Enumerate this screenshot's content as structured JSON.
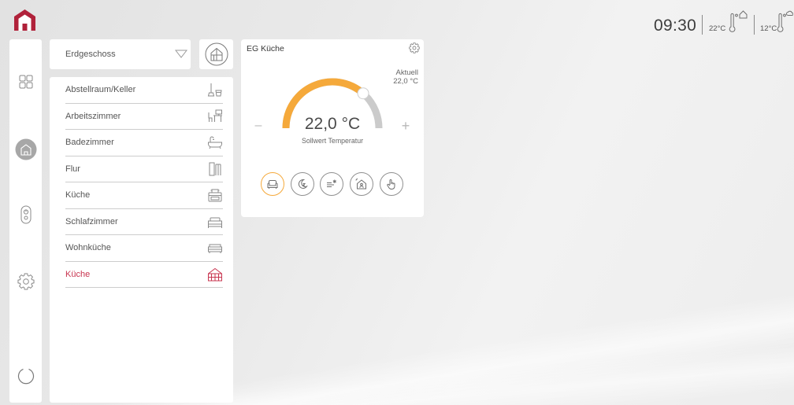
{
  "app": {
    "logo_icon": "home-logo-icon",
    "brand_color": "#b0213a",
    "accent_color": "#f5a93b",
    "selected_color": "#c8344f"
  },
  "header": {
    "time": "09:30",
    "indoor": {
      "temperature": "22°C",
      "icon": "thermometer-home-icon"
    },
    "outdoor": {
      "temperature": "12°C",
      "icon": "thermometer-weather-icon"
    }
  },
  "sidebar": {
    "items": [
      {
        "icon": "grid-icon",
        "active": false
      },
      {
        "icon": "home-icon",
        "active": true
      },
      {
        "icon": "remote-control-icon",
        "active": false
      },
      {
        "icon": "gear-icon",
        "active": false
      },
      {
        "icon": "refresh-icon",
        "active": false
      }
    ]
  },
  "floor_select": {
    "value": "Erdgeschoss",
    "icon": "chevron-down-icon"
  },
  "floorplan_button": {
    "icon": "floorplan-icon"
  },
  "rooms": [
    {
      "label": "Abstellraum/Keller",
      "icon": "storage-icon",
      "selected": false
    },
    {
      "label": "Arbeitszimmer",
      "icon": "desk-icon",
      "selected": false
    },
    {
      "label": "Badezimmer",
      "icon": "bathtub-icon",
      "selected": false
    },
    {
      "label": "Flur",
      "icon": "hallway-icon",
      "selected": false
    },
    {
      "label": "Küche",
      "icon": "stove-icon",
      "selected": false
    },
    {
      "label": "Schlafzimmer",
      "icon": "bed-icon",
      "selected": false
    },
    {
      "label": "Wohnküche",
      "icon": "sofa-icon",
      "selected": false
    },
    {
      "label": "Küche",
      "icon": "kitchen-house-icon",
      "selected": true
    }
  ],
  "room_card": {
    "title": "EG Küche",
    "settings_icon": "gear-icon",
    "current_label": "Aktuell",
    "current_value": "22,0 °C",
    "setpoint_value": "22,0 °C",
    "setpoint_label": "Sollwert Temperatur",
    "decrease_label": "–",
    "increase_label": "+",
    "gauge_level": 0.73,
    "modes": [
      {
        "icon": "comfort-mode-icon",
        "active": true
      },
      {
        "icon": "night-mode-icon",
        "active": false
      },
      {
        "icon": "frost-protection-icon",
        "active": false
      },
      {
        "icon": "away-mode-icon",
        "active": false
      },
      {
        "icon": "manual-mode-icon",
        "active": false
      }
    ]
  }
}
